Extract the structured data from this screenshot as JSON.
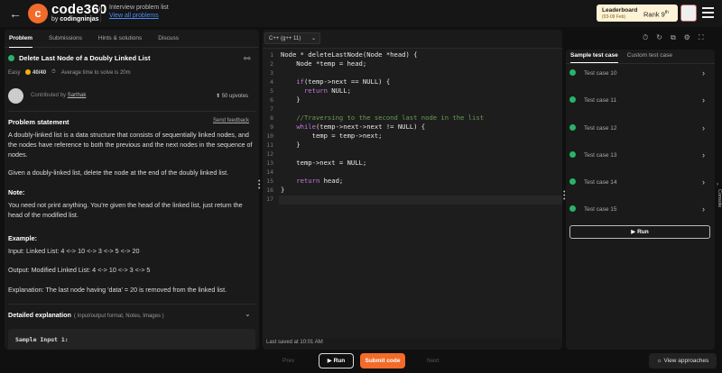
{
  "topbar": {
    "brand_mark": "c",
    "brand": "code360",
    "brand_sub_prefix": "by",
    "brand_sub_name": "codingninjas",
    "list_title": "Interview problem list",
    "list_link": "View all problems",
    "leaderboard_title": "Leaderboard",
    "leaderboard_sub": "(03-09 Feb)",
    "rank_label": "Rank 9",
    "rank_suffix": "th"
  },
  "left": {
    "tabs": [
      "Problem",
      "Submissions",
      "Hints & solutions",
      "Discuss"
    ],
    "title": "Delete Last Node of a Doubly Linked List",
    "difficulty": "Easy",
    "score": "40/40",
    "avg_time": "Average time to solve is 20m",
    "contributed_by": "Contributed by",
    "contributor": "Sarthak",
    "upvotes": "50 upvotes",
    "statement_heading": "Problem statement",
    "send_feedback": "Send feedback",
    "para1": "A doubly-linked list is a data structure that consists of sequentially linked nodes, and the nodes have reference to both the previous and the next nodes in the sequence of nodes.",
    "para2": "Given a doubly-linked list, delete the node at the end of the doubly linked list.",
    "note_heading": "Note:",
    "note_text": "You need not print anything. You're given the head of the linked list, just return the head of the modified list.",
    "example_heading": "Example:",
    "example_input": "Input: Linked List:  4 <-> 10 <-> 3 <-> 5 <-> 20",
    "example_output": "Output: Modified Linked List: 4 <-> 10 <-> 3 <-> 5",
    "explanation": "Explanation: The last node having 'data' = 20 is removed from the linked list.",
    "detailed_heading": "Detailed explanation",
    "detailed_sub": "( Input/output format, Notes, Images )",
    "sample_input": "Sample Input 1:"
  },
  "editor": {
    "language": "C++ (g++ 11)",
    "line_numbers": [
      "1",
      "2",
      "3",
      "4",
      "5",
      "6",
      "7",
      "8",
      "9",
      "10",
      "11",
      "12",
      "13",
      "14",
      "15",
      "16",
      "17"
    ],
    "saved": "Last saved at 10:01 AM"
  },
  "right": {
    "tabs": [
      "Sample test case",
      "Custom test case"
    ],
    "test_cases": [
      "Test case 10",
      "Test case 11",
      "Test case 12",
      "Test case 13",
      "Test case 14",
      "Test case 15"
    ],
    "run_label": "Run",
    "console_label": "Console"
  },
  "bottom": {
    "prev": "Prev",
    "run": "Run",
    "submit": "Submit code",
    "next": "Next",
    "view_approaches": "View approaches"
  },
  "colors": {
    "accent": "#f26b2a",
    "success": "#28b36b",
    "link": "#4a8cf6"
  }
}
